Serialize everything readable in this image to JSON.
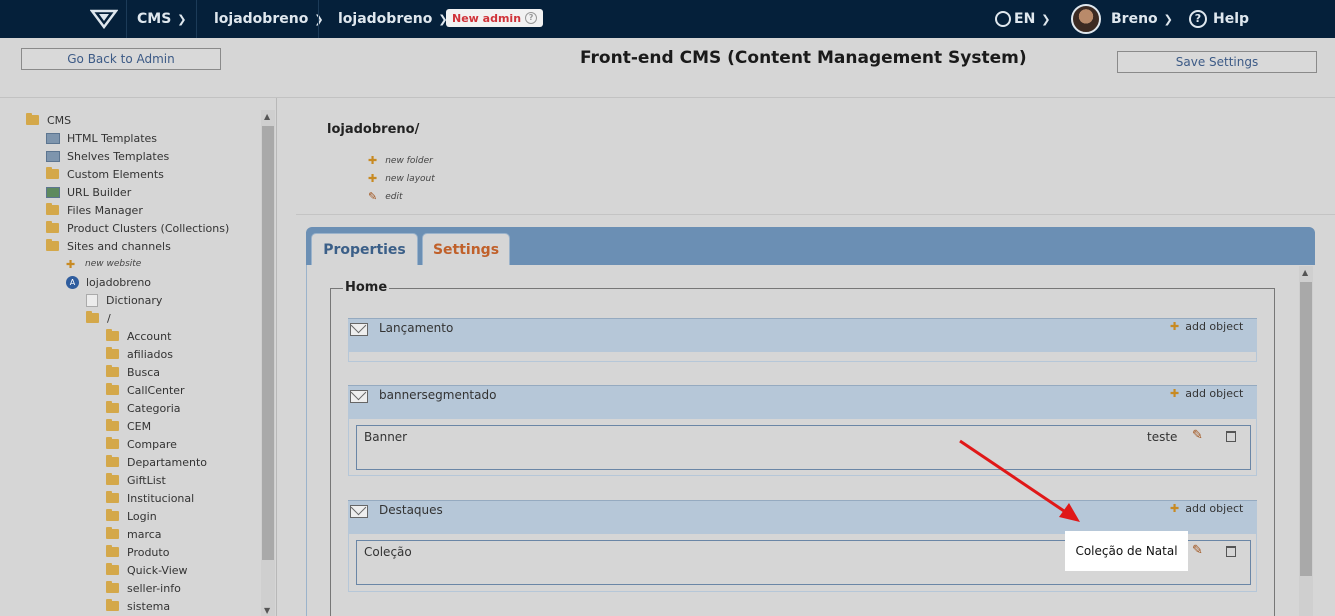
{
  "topbar": {
    "cms": "CMS",
    "store": "lojadobreno",
    "account": "lojadobreno",
    "new_admin": "New admin",
    "language": "EN",
    "user": "Breno",
    "help": "Help"
  },
  "header": {
    "back_button": "Go Back to Admin",
    "title": "Front-end CMS (Content Management System)",
    "save_button": "Save Settings"
  },
  "tree": {
    "root": "CMS",
    "items": [
      "HTML Templates",
      "Shelves Templates",
      "Custom Elements",
      "URL Builder",
      "Files Manager",
      "Product Clusters (Collections)",
      "Sites and channels"
    ],
    "new_website": "new website",
    "site": "lojadobreno",
    "dictionary": "Dictionary",
    "root_folder": "/",
    "folders": [
      "Account",
      "afiliados",
      "Busca",
      "CallCenter",
      "Categoria",
      "CEM",
      "Compare",
      "Departamento",
      "GiftList",
      "Institucional",
      "Login",
      "marca",
      "Produto",
      "Quick-View",
      "seller-info",
      "sistema"
    ]
  },
  "main": {
    "path": "lojadobreno/",
    "actions": [
      "new folder",
      "new layout",
      "edit"
    ],
    "tabs": [
      "Properties",
      "Settings"
    ],
    "legend": "Home",
    "add_object": "add object",
    "slots": [
      {
        "name": "Lançamento"
      },
      {
        "name": "bannersegmentado",
        "object": {
          "type": "Banner",
          "name": "teste"
        }
      },
      {
        "name": "Destaques",
        "object": {
          "type": "Coleção",
          "name": "Coleção de Natal"
        }
      }
    ]
  },
  "colors": {
    "topbar": "#05203a",
    "tab_bar": "#6b8fb4",
    "new_admin": "#d0333a",
    "annotation_arrow": "#e01818"
  }
}
